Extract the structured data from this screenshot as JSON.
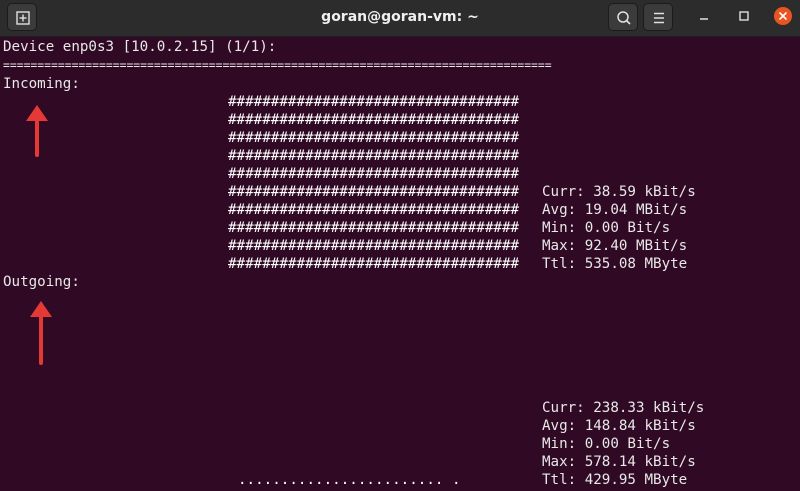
{
  "window": {
    "title": "goran@goran-vm: ~",
    "colors": {
      "background": "#300a24",
      "titlebar": "#2c2c2c",
      "close": "#e95420",
      "arrow": "#e53935"
    }
  },
  "titlebar_buttons": {
    "new_tab_icon": "new-tab-icon",
    "search_icon": "search-icon",
    "menu_icon": "hamburger-menu-icon",
    "minimize_icon": "minimize-icon",
    "maximize_icon": "maximize-icon",
    "close_icon": "close-icon"
  },
  "terminal": {
    "device_line": "Device enp0s3 [10.0.2.15] (1/1):",
    "separator": "================================================================================",
    "incoming": {
      "label": "Incoming:",
      "graph_rows": [
        "##################################",
        "##################################",
        "##################################",
        "##################################",
        "##################################",
        "##################################",
        "##################################",
        "##################################",
        "##################################",
        "##################################"
      ],
      "stats": {
        "curr": "Curr: 38.59 kBit/s",
        "avg": "Avg: 19.04 MBit/s",
        "min": "Min: 0.00 Bit/s",
        "max": "Max: 92.40 MBit/s",
        "ttl": "Ttl: 535.08 MByte"
      }
    },
    "outgoing": {
      "label": "Outgoing:",
      "graph_row": "........................ .",
      "stats": {
        "curr": "Curr: 238.33 kBit/s",
        "avg": "Avg: 148.84 kBit/s",
        "min": "Min: 0.00 Bit/s",
        "max": "Max: 578.14 kBit/s",
        "ttl": "Ttl: 429.95 MByte"
      }
    }
  },
  "annotations": {
    "incoming_arrow_icon": "red-up-arrow-icon",
    "outgoing_arrow_icon": "red-up-arrow-icon"
  }
}
